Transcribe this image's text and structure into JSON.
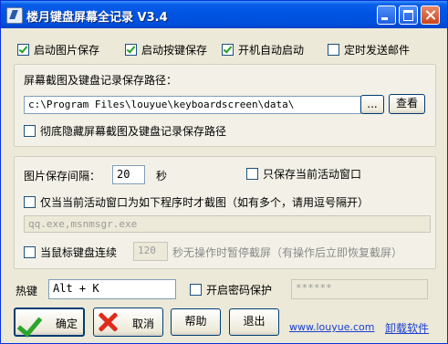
{
  "window": {
    "title": "楼月键盘屏幕全记录 V3.4"
  },
  "top_options": [
    {
      "label": "启动图片保存",
      "checked": true
    },
    {
      "label": "启动按键保存",
      "checked": true
    },
    {
      "label": "开机自动启动",
      "checked": true
    },
    {
      "label": "定时发送邮件",
      "checked": false
    }
  ],
  "path_group": {
    "heading": "屏幕截图及键盘记录保存路径：",
    "path_value": "c:\\Program Files\\louyue\\keyboardscreen\\data\\",
    "browse_label": "...",
    "view_label": "查看",
    "hide_label": "彻底隐藏屏幕截图及键盘记录保存路径",
    "hide_checked": false
  },
  "capture_group": {
    "interval_label": "图片保存间隔：",
    "interval_value": "20",
    "interval_unit": "秒",
    "active_only_label": "只保存当前活动窗口",
    "active_only_checked": false,
    "program_filter_label": "仅当当前活动窗口为如下程序时才截图（如有多个，请用逗号隔开）",
    "program_filter_checked": false,
    "program_list_value": "qq.exe,msnmsgr.exe",
    "idle_prefix": "当鼠标键盘连续",
    "idle_checked": false,
    "idle_value": "120",
    "idle_suffix": "秒无操作时暂停截屏（有操作后立即恢复截屏）"
  },
  "hotkey": {
    "label": "热键",
    "value": "Alt + K"
  },
  "password": {
    "label": "开启密码保护",
    "checked": false,
    "value": "******"
  },
  "buttons": {
    "ok": "确定",
    "cancel": "取消",
    "help": "帮助",
    "exit": "退出"
  },
  "footer": {
    "website": "www.louyue.com",
    "uninstall": "卸载软件"
  }
}
